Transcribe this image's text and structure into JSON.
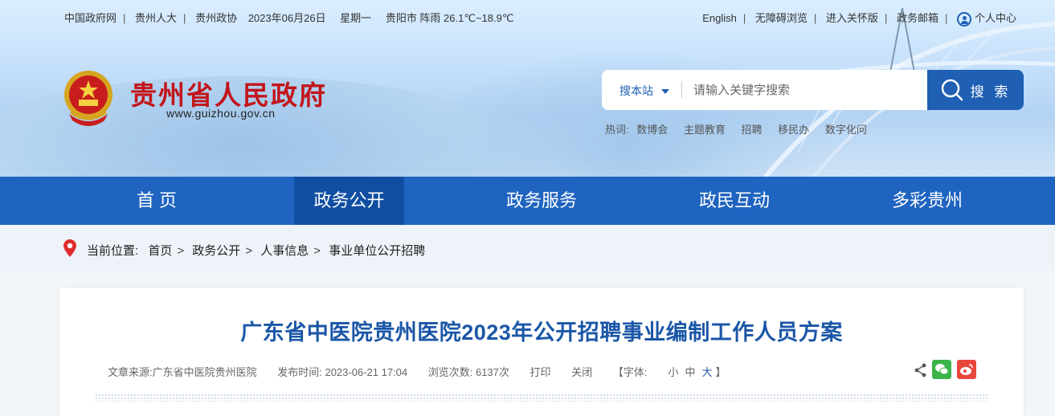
{
  "topbar": {
    "links_left": [
      "中国政府网",
      "贵州人大",
      "贵州政协"
    ],
    "date": "2023年06月26日",
    "weekday": "星期一",
    "weather": "贵阳市 阵雨 26.1℃~18.9℃",
    "links_right": [
      "English",
      "无障碍浏览",
      "进入关怀版",
      "政务邮箱"
    ],
    "user_center": "个人中心"
  },
  "site": {
    "title": "贵州省人民政府",
    "url": "www.guizhou.gov.cn"
  },
  "search": {
    "scope": "搜本站",
    "placeholder": "请输入关键字搜索",
    "button": "搜 索",
    "hot_label": "热词:",
    "hot_words": [
      "数博会",
      "主题教育",
      "招聘",
      "移民办",
      "数字化问"
    ]
  },
  "nav": [
    "首 页",
    "政务公开",
    "政务服务",
    "政民互动",
    "多彩贵州"
  ],
  "nav_active": "政务公开",
  "breadcrumb": {
    "label": "当前位置:",
    "items": [
      "首页",
      "政务公开",
      "人事信息",
      "事业单位公开招聘"
    ]
  },
  "article": {
    "title": "广东省中医院贵州医院2023年公开招聘事业编制工作人员方案",
    "source": "文章来源:广东省中医院贵州医院",
    "time": "发布时间: 2023-06-21 17:04",
    "views": "浏览次数: 6137次",
    "print": "打印",
    "close": "关闭",
    "font_prefix": "【字体:",
    "font_small": "小",
    "font_medium": "中",
    "font_large": "大",
    "font_suffix": "】"
  },
  "colors": {
    "brand_blue": "#1f64c0",
    "nav_active": "#0f4ea2",
    "title_red": "#c3151b",
    "title_blue": "#1b57a7"
  },
  "icons": [
    "user-icon",
    "emblem-icon",
    "caret-down-icon",
    "search-icon",
    "location-pin-icon",
    "share-icon",
    "wechat-icon",
    "weibo-icon"
  ]
}
